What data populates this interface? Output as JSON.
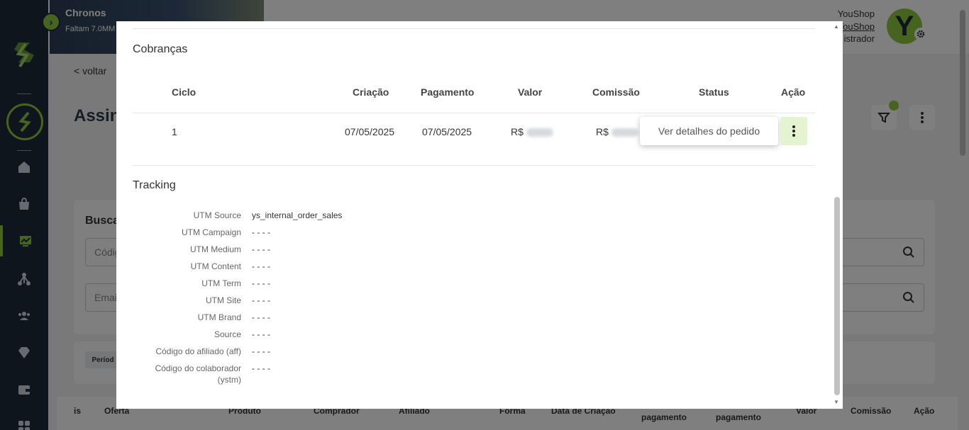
{
  "banner": {
    "title": "Chronos",
    "subtitle": "Faltam 7.0MM"
  },
  "user": {
    "name": "YouShop",
    "shop": "YouShop",
    "role": "istrador",
    "avatar_letter": "Y"
  },
  "page": {
    "back_label": "< voltar",
    "title": "Assin",
    "search_title": "Busca",
    "input_code_placeholder": "Códig",
    "input_email_placeholder": "Emai",
    "periodo_label": "Períod"
  },
  "background_table": {
    "headers": [
      "is",
      "Oferta",
      "Produto",
      "Comprador",
      "Afiliado",
      "Forma",
      "Data de Criação",
      "pagamento",
      "pagamento",
      "Valor",
      "Comissão",
      "Ação"
    ]
  },
  "modal": {
    "charges": {
      "title": "Cobranças",
      "headers": {
        "ciclo": "Ciclo",
        "criacao": "Criação",
        "pagamento": "Pagamento",
        "valor": "Valor",
        "comissao": "Comissão",
        "status": "Status",
        "acao": "Ação"
      },
      "rows": [
        {
          "ciclo": "1",
          "criacao": "07/05/2025",
          "pagamento": "07/05/2025",
          "valor_prefix": "R$",
          "comissao_prefix": "R$"
        }
      ],
      "dropdown_option": "Ver detalhes do pedido"
    },
    "tracking": {
      "title": "Tracking",
      "fields": [
        {
          "label": "UTM Source",
          "value": "ys_internal_order_sales"
        },
        {
          "label": "UTM Campaign",
          "value": "- - - -"
        },
        {
          "label": "UTM Medium",
          "value": "- - - -"
        },
        {
          "label": "UTM Content",
          "value": "- - - -"
        },
        {
          "label": "UTM Term",
          "value": "- - - -"
        },
        {
          "label": "UTM Site",
          "value": "- - - -"
        },
        {
          "label": "UTM Brand",
          "value": "- - - -"
        },
        {
          "label": "Source",
          "value": "- - - -"
        },
        {
          "label": "Código do afiliado (aff)",
          "value": "- - - -"
        },
        {
          "label": "Código do colaborador",
          "label2": "(ystm)",
          "value": "- - - -"
        }
      ]
    }
  },
  "colors": {
    "sidebar": "#1f2b3a",
    "accent": "#8dc63f",
    "action_bg": "#e4f3d0"
  }
}
